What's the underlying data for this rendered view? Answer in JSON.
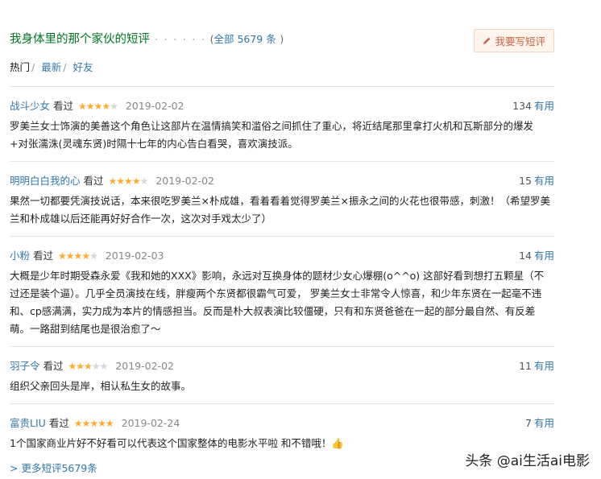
{
  "header": {
    "title": "我身体里的那个家伙的短评",
    "dots": "· · · · · ·",
    "paren_open": "(",
    "all_label": "全部 5679 条",
    "paren_close": ")",
    "write_button": "我要写短评"
  },
  "tabs": [
    {
      "label": "热门",
      "active": true
    },
    {
      "label": "最新",
      "active": false
    },
    {
      "label": "好友",
      "active": false
    }
  ],
  "tab_separator": "/",
  "seen_label": "看过",
  "useful_label": "有用",
  "comments": [
    {
      "user": "战斗少女",
      "rating": 4,
      "date": "2019-02-02",
      "votes": "134",
      "text": "罗美兰女士饰演的美善这个角色让这部片在温情搞笑和滥俗之间抓住了重心，将近结尾那里拿打火机和瓦斯部分的爆发+对张濡洙(灵魂东贤)时隔十七年的内心告白看哭，喜欢演技派。"
    },
    {
      "user": "明明白白我的心",
      "rating": 4,
      "date": "2019-02-02",
      "votes": "15",
      "text": "果然一切都要凭演技说话，本来很吃罗美兰×朴成雄，看着看着觉得罗美兰×振永之间的火花也很带感，刺激！（希望罗美兰和朴成雄以后还能再好好合作一次，这次对手戏太少了）"
    },
    {
      "user": "小粉",
      "rating": 4,
      "date": "2019-02-03",
      "votes": "14",
      "text": "大概是少年时期受森永爱《我和她的XXX》影响，永远对互换身体的题材少女心爆棚(o^^o) 这部好看到想打五颗星（不过还是装个逼）。几乎全员演技在线，胖瘦两个东贤都很霸气可爱， 罗美兰女士非常令人惊喜，和少年东贤在一起毫不违和、cp感满满，实力成为本片的情感担当。反而是朴大叔表演比较僵硬，只有和东贤爸爸在一起的部分最自然、有反差萌。一路甜到结尾也是很治愈了～"
    },
    {
      "user": "羽子令",
      "rating": 3,
      "date": "2019-02-02",
      "votes": "11",
      "text": "组织父亲回头是岸，相认私生女的故事。"
    },
    {
      "user": "富贵LIU",
      "rating": 5,
      "date": "2019-02-24",
      "votes": "7",
      "text": "1个国家商业片好不好看可以代表这个国家整体的电影水平啦 和不错哦！👍"
    }
  ],
  "more_link": "> 更多短评5679条",
  "watermark": "头条 @ai生活ai电影",
  "colors": {
    "title_green": "#007722",
    "link_blue": "#3377aa",
    "star": "#ffac2d",
    "button_bg": "#fff5ed",
    "button_text": "#ca6445"
  },
  "icons": {
    "write": "pencil-icon",
    "star": "star-icon"
  }
}
